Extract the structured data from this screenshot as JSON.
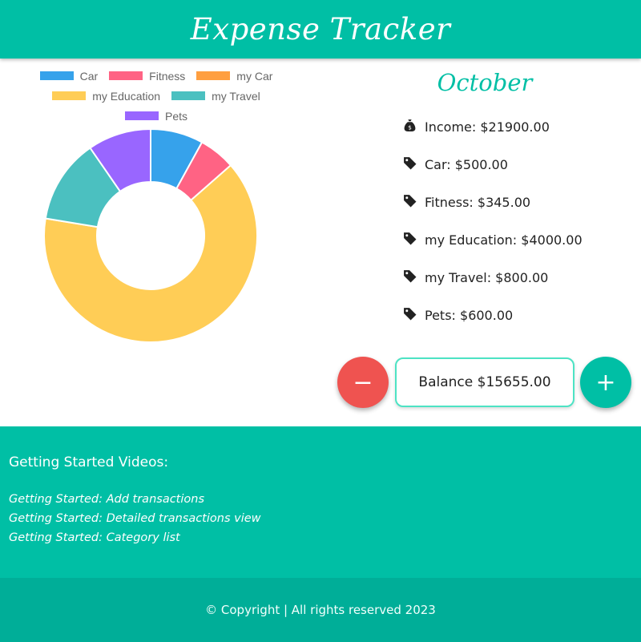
{
  "header": {
    "title": "Expense Tracker"
  },
  "chart_data": {
    "type": "pie",
    "categories": [
      "Car",
      "Fitness",
      "my Car",
      "my Education",
      "my Travel",
      "Pets"
    ],
    "values": [
      500,
      345,
      0,
      4000,
      800,
      600
    ],
    "colors": [
      "#36A2EB",
      "#FF6384",
      "#FF9F40",
      "#FFCD56",
      "#4BC0C0",
      "#9966FF"
    ],
    "donut": true,
    "legend_position": "top"
  },
  "summary": {
    "month": "October",
    "income": "Income: $21900.00",
    "items": [
      "Car: $500.00",
      "Fitness: $345.00",
      "my Education: $4000.00",
      "my Travel: $800.00",
      "Pets: $600.00"
    ]
  },
  "actions": {
    "minus_label": "−",
    "plus_label": "+",
    "balance": "Balance $15655.00"
  },
  "footer": {
    "heading": "Getting Started Videos:",
    "links": [
      "Getting Started: Add transactions",
      "Getting Started: Detailed transactions view",
      "Getting Started: Category list"
    ],
    "copyright": "© Copyright | All rights reserved 2023"
  },
  "icons": {
    "income": "money-bag-icon",
    "category": "tag-icon"
  },
  "colors": {
    "accent": "#00BFA5",
    "danger": "#EF5350"
  }
}
